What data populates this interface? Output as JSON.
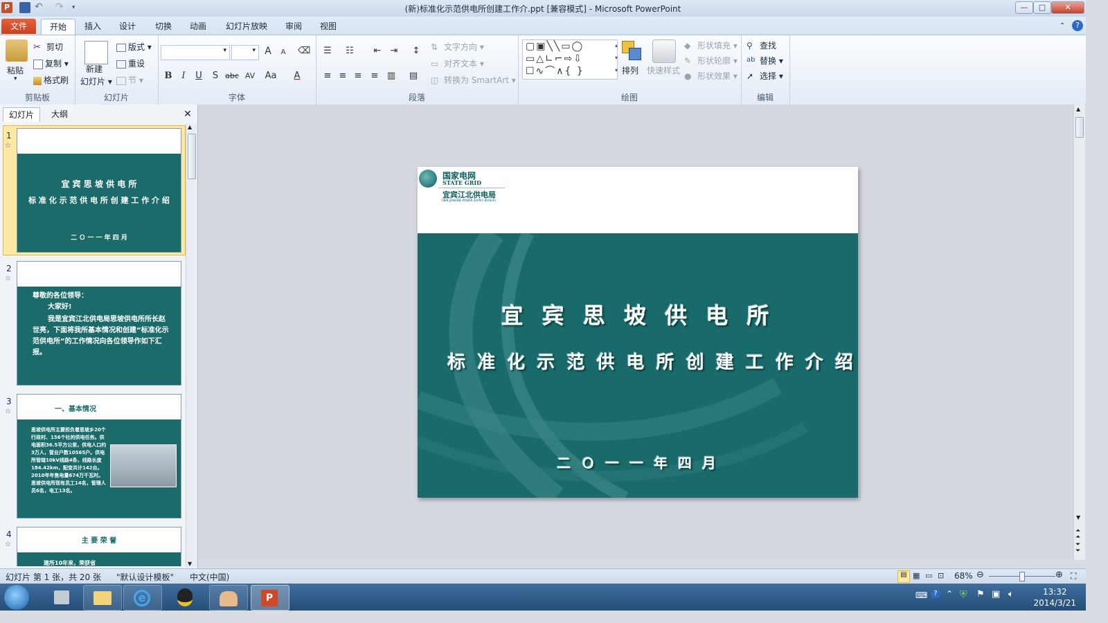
{
  "window": {
    "title": "(新)标准化示范供电所创建工作介.ppt [兼容模式]  -  Microsoft PowerPoint"
  },
  "tabs": [
    "文件",
    "开始",
    "插入",
    "设计",
    "切换",
    "动画",
    "幻灯片放映",
    "审阅",
    "视图"
  ],
  "ribbon": {
    "clipboard": {
      "paste": "粘贴",
      "cut": "剪切",
      "copy": "复制",
      "format_painter": "格式刷",
      "label": "剪贴板"
    },
    "slides": {
      "new_slide_1": "新建",
      "new_slide_2": "幻灯片",
      "layout": "版式",
      "reset": "重设",
      "section": "节",
      "label": "幻灯片"
    },
    "font": {
      "label": "字体",
      "bold": "B",
      "italic": "I",
      "underline": "U",
      "shadow": "S",
      "strike": "abc",
      "aa": "Aa",
      "grow": "A",
      "shrink": "A",
      "font_color": "A"
    },
    "paragraph": {
      "text_direction": "文字方向",
      "align_text": "对齐文本",
      "smartart": "转换为 SmartArt",
      "label": "段落"
    },
    "drawing": {
      "arrange": "排列",
      "quick_styles": "快速样式",
      "shape_fill": "形状填充",
      "shape_outline": "形状轮廓",
      "shape_effects": "形状效果",
      "label": "绘图"
    },
    "editing": {
      "find": "查找",
      "replace": "替换",
      "select": "选择",
      "label": "编辑"
    }
  },
  "pane": {
    "tab_slides": "幻灯片",
    "tab_outline": "大纲"
  },
  "thumbnails": [
    {
      "num": "1",
      "line1": "宜 宾 思 坡 供 电 所",
      "line2": "标 准 化 示 范 供 电 所 创 建 工 作 介 绍",
      "line3": "二 Ｏ 一 一 年 四 月"
    },
    {
      "num": "2",
      "line1": "尊敬的各位领导：",
      "line2": "大家好!",
      "line3": "我是宜宾江北供电局思坡供电所所长赵世亮，下面将我所基本情况和创建“标准化示范供电所”的工作情况向各位领导作如下汇报。"
    },
    {
      "num": "3",
      "heading": "一、基本情况",
      "body": "思坡供电所主要担负着思坡乡20个行政村、156个社的供电任务。供电面积36.5平方公里，供电人口约3万人，营业户数10565户。供电所管辖10kV线路4条，线路长度184.42km，配变共计142台。2010年年售电量674万千瓦时。思坡供电所现有员工14名，管理人员6名，电工13名。"
    },
    {
      "num": "4",
      "heading": "主 要 荣 誉",
      "body": "建所10年来，荣获省"
    }
  ],
  "logo": {
    "cn": "国家电网",
    "en": "STATE GRID",
    "bureau": "宜宾江北供电局",
    "bureau_en": "YIBIN JIANGBEI POWER SUPPLY BUREAU"
  },
  "slide": {
    "title1": "宜 宾 思 坡 供 电 所",
    "title2": "标 准 化 示 范 供 电 所 创 建 工 作 介 绍",
    "date": "二 Ｏ 一 一 年 四 月"
  },
  "status": {
    "slide_info": "幻灯片 第 1 张，共 20 张",
    "theme": "\"默认设计模板\"",
    "language": "中文(中国)",
    "zoom": "68%",
    "zoom_fraction": 0.5
  },
  "taskbar": {
    "time": "13:32",
    "date": "2014/3/21"
  },
  "colors": {
    "slide_green": "#196a6a",
    "file_tab": "#d9502c",
    "ribbon_bg": "#f3f6fb"
  }
}
